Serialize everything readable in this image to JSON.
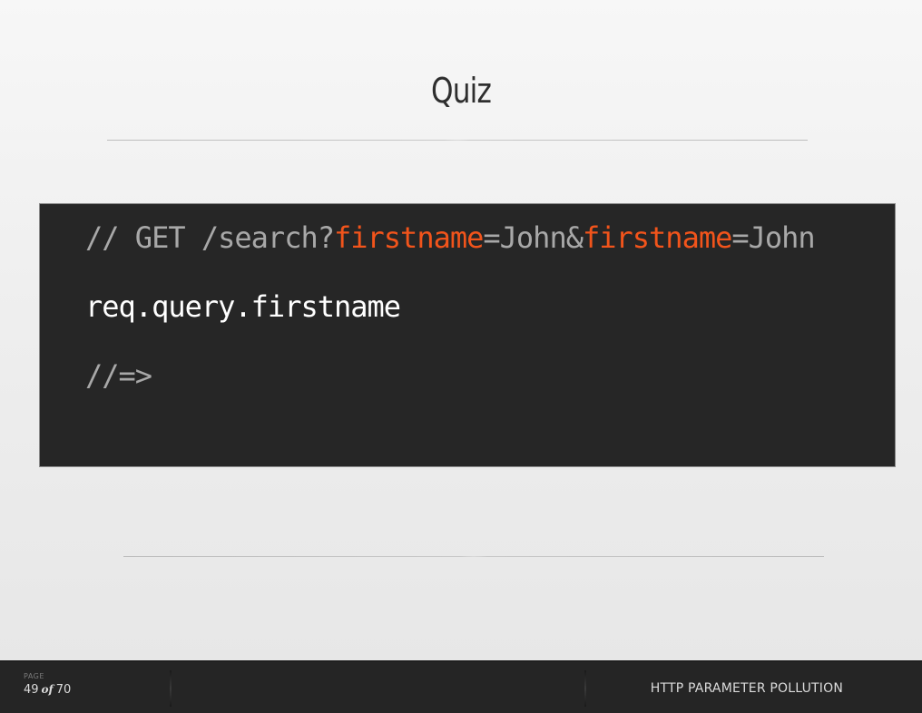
{
  "slide": {
    "title": "Quiz"
  },
  "code": {
    "line1": {
      "part1": "// GET /search?",
      "param1": "firstname",
      "part2": "=John&",
      "param2": "firstname",
      "part3": "=John"
    },
    "line2": "req.query.firstname",
    "line3": "//=>"
  },
  "footer": {
    "page_label": "PAGE",
    "current_page": "49",
    "of_label": "of",
    "total_pages": "70",
    "presentation_title": "HTTP PARAMETER POLLUTION"
  },
  "colors": {
    "highlight": "#f2541b",
    "code_background": "#262626",
    "footer_background": "#252525"
  }
}
